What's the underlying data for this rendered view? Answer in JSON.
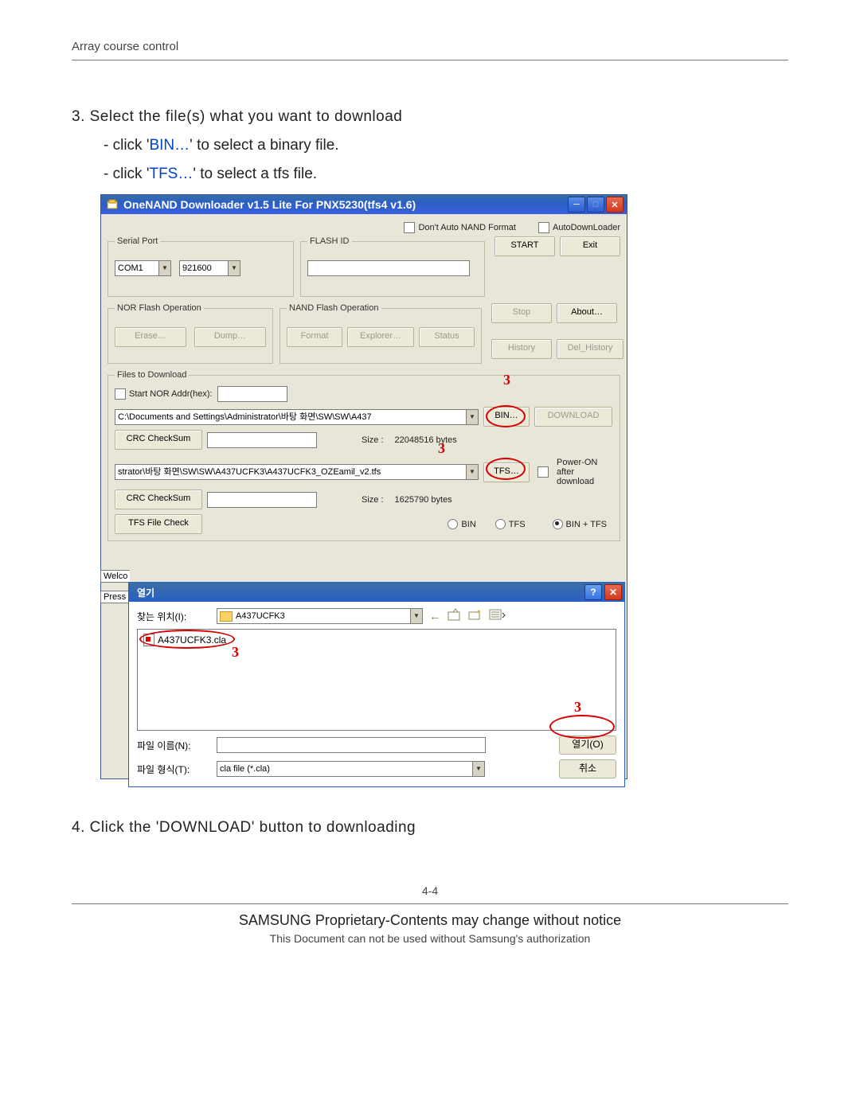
{
  "doc": {
    "header": "Array course control",
    "step3_title": "3. Select the file(s) what you want to download",
    "step3_sub1_pre": "- click '",
    "step3_sub1_hl": "BIN…",
    "step3_sub1_post": "' to select a binary file.",
    "step3_sub2_pre": "- click '",
    "step3_sub2_hl": "TFS…",
    "step3_sub2_post": "' to select a tfs file.",
    "step4_title": "4. Click the 'DOWNLOAD' button to downloading",
    "page_num": "4-4",
    "footer1": "SAMSUNG Proprietary-Contents may change without notice",
    "footer2": "This Document can not be used without Samsung's authorization"
  },
  "app": {
    "title": "OneNAND Downloader v1.5 Lite For PNX5230(tfs4 v1.6)",
    "check_dont_auto": "Don't Auto NAND Format",
    "check_autodl": "AutoDownLoader",
    "fs_serial": "Serial Port",
    "com_value": "COM1",
    "baud_value": "921600",
    "fs_flashid": "FLASH ID",
    "btn_start": "START",
    "btn_exit": "Exit",
    "btn_stop": "Stop",
    "btn_about": "About…",
    "btn_history": "History",
    "btn_delhist": "Del_History",
    "fs_nor": "NOR Flash Operation",
    "btn_erase": "Erase…",
    "btn_dump": "Dump…",
    "fs_nand": "NAND Flash Operation",
    "btn_format": "Format",
    "btn_explorer": "Explorer…",
    "btn_status": "Status",
    "fs_files": "Files to Download",
    "check_startnor": "Start NOR Addr(hex):",
    "path_bin": "C:\\Documents and Settings\\Administrator\\바탕 화면\\SW\\SW\\A437",
    "btn_bin": "BIN…",
    "btn_download": "DOWNLOAD",
    "btn_crc": "CRC CheckSum",
    "size_label": "Size :",
    "size_bin": "22048516 bytes",
    "path_tfs": "strator\\바탕 화면\\SW\\SW\\A437UCFK3\\A437UCFK3_OZEamil_v2.tfs",
    "btn_tfs": "TFS…",
    "poweron_label": "Power-ON after download",
    "size_tfs": "1625790 bytes",
    "btn_tfscheck": "TFS File Check",
    "radio_bin": "BIN",
    "radio_tfs": "TFS",
    "radio_bintfs": "BIN + TFS",
    "side_welco": "Welco",
    "side_press": "Press"
  },
  "dlg": {
    "title": "열기",
    "lookin_label": "찾는 위치(I):",
    "lookin_value": "A437UCFK3",
    "file_item": "A437UCFK3.cla",
    "filename_label": "파일 이름(N):",
    "filename_value": "",
    "filetype_label": "파일 형식(T):",
    "filetype_value": "cla file (*.cla)",
    "btn_open": "열기(O)",
    "btn_cancel": "취소"
  },
  "callouts": {
    "c1": "3",
    "c2": "3",
    "c3": "3",
    "c4": "3"
  }
}
